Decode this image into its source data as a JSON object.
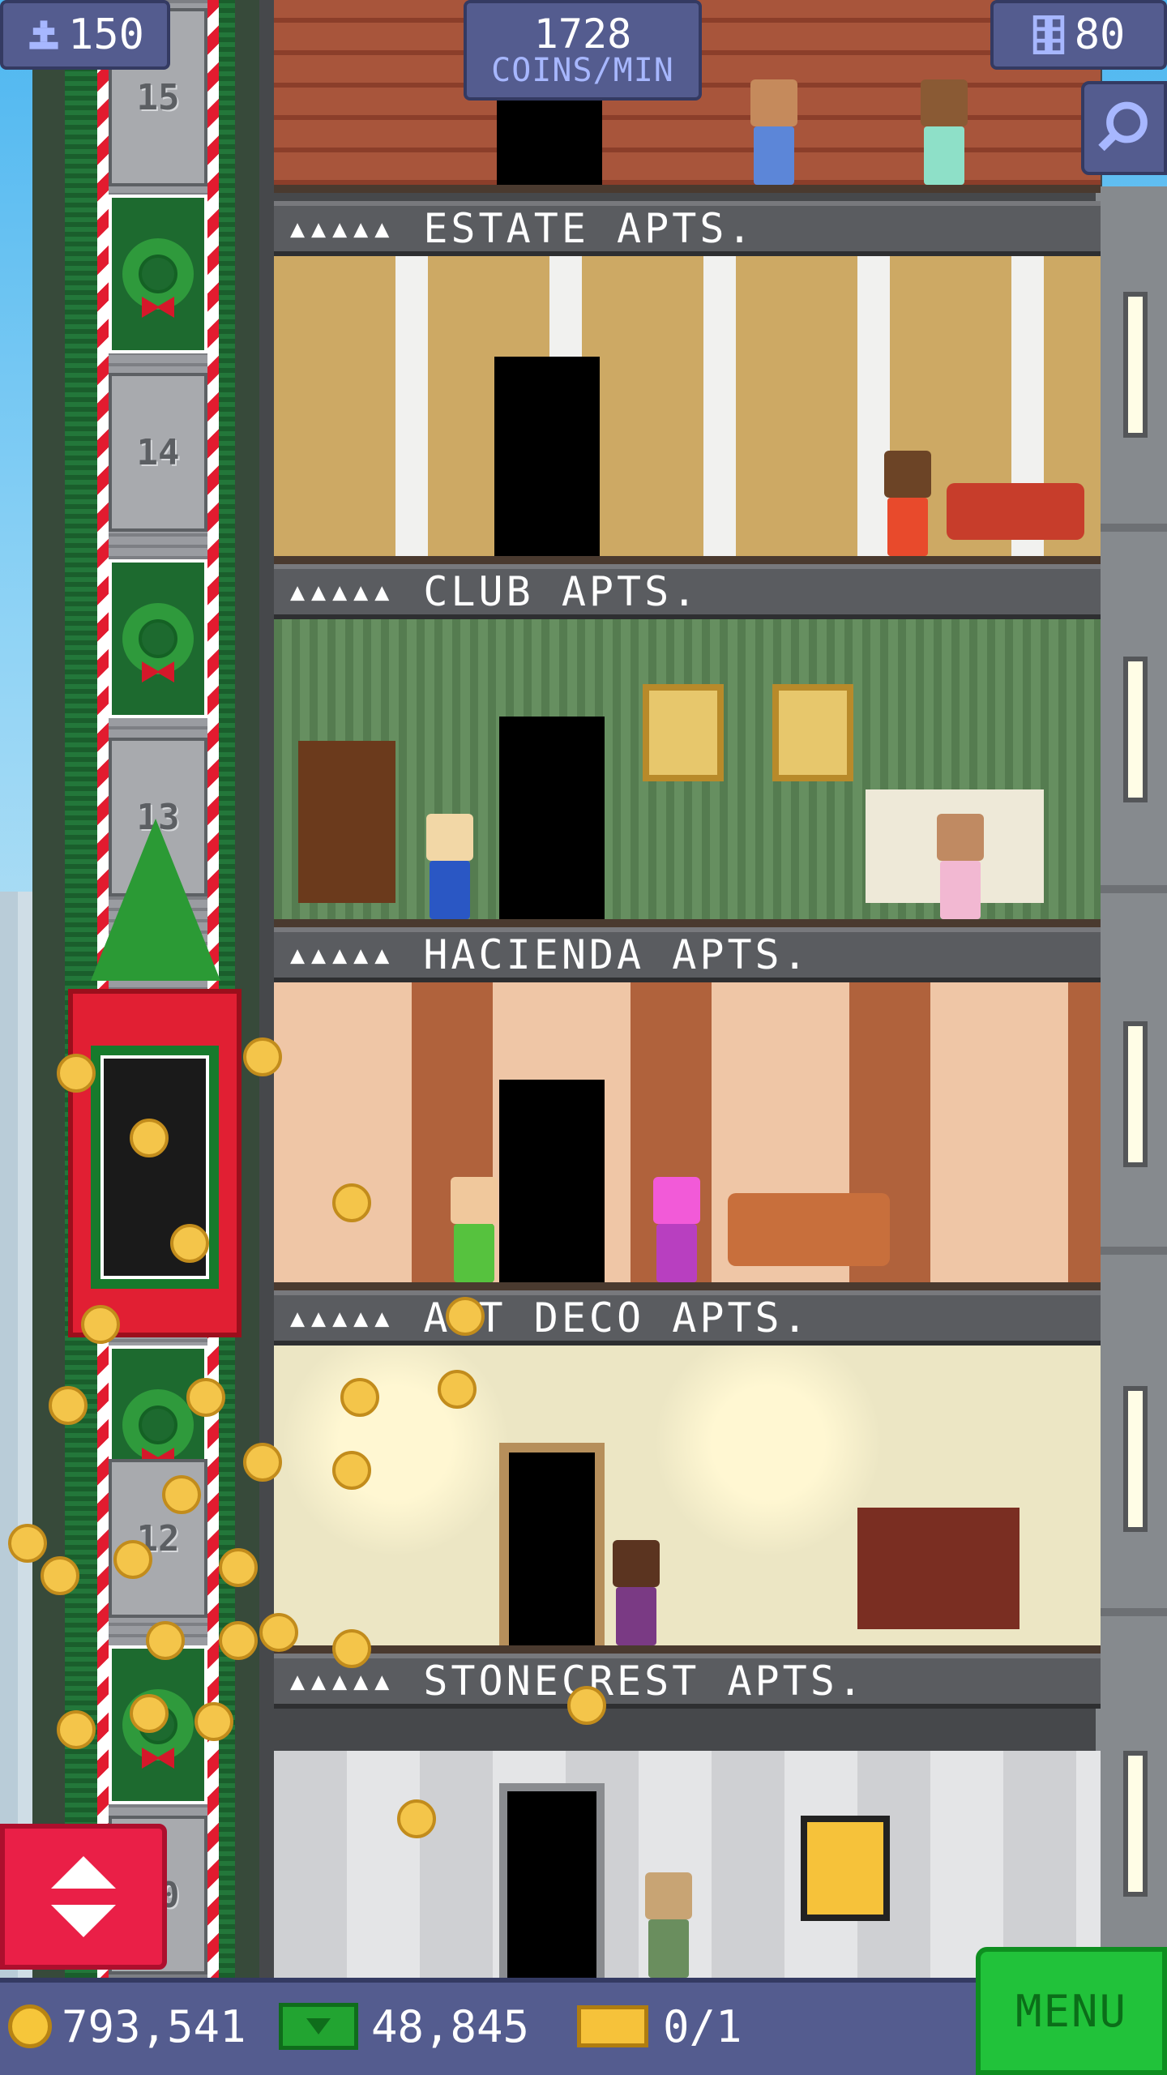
{
  "hud": {
    "population": "150",
    "coin_rate_value": "1728",
    "coin_rate_unit": "COINS/MIN",
    "floor_count": "80"
  },
  "elevator": {
    "floor_labels": [
      "15",
      "14",
      "13",
      "12",
      "10"
    ]
  },
  "banners": [
    {
      "people": "▲▲▲▲▲",
      "name": "ESTATE APTS."
    },
    {
      "people": "▲▲▲▲▲",
      "name": "CLUB APTS."
    },
    {
      "people": "▲▲▲▲▲",
      "name": "HACIENDA APTS."
    },
    {
      "people": "▲▲▲▲▲",
      "name": "ART DECO APTS."
    },
    {
      "people": "▲▲▲▲▲",
      "name": "STONECREST APTS."
    }
  ],
  "bottom_bar": {
    "coins": "793,541",
    "tower_bux": "48,845",
    "tickets": "0/1",
    "menu_label": "MENU"
  },
  "icons": {
    "population": "person-icon",
    "floors": "building-icon",
    "search": "magnifier-icon",
    "coins": "coin-icon",
    "bux": "bux-icon",
    "ticket": "ticket-icon",
    "elevator": "up-down-arrows-icon"
  },
  "colors": {
    "hud": "#545c8f",
    "menu": "#21c23a",
    "elevator_button": "#ea1f47"
  }
}
